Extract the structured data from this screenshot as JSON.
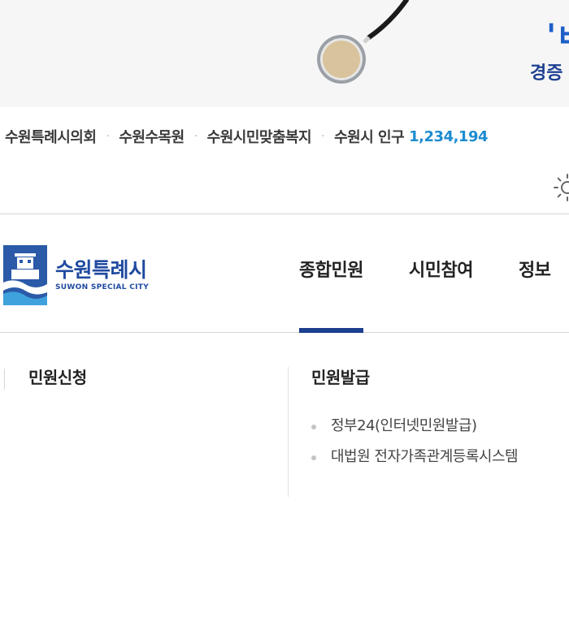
{
  "banner": {
    "headline": "'ㅂ",
    "subline": "경증"
  },
  "quick_links": [
    "수원특례시의회",
    "수원수목원",
    "수원시민맞춤복지"
  ],
  "population": {
    "label": "수원시 인구",
    "value": "1,234,194"
  },
  "header": {
    "logo_title": "수원특례시",
    "logo_subtitle": "SUWON SPECIAL CITY",
    "gnb": [
      "종합민원",
      "시민참여",
      "정보"
    ]
  },
  "submenu": {
    "left_title": "민원신청",
    "right_title": "민원발급",
    "right_items": [
      "정부24(인터넷민원발급)",
      "대법원 전자가족관계등록시스템"
    ]
  },
  "icons": {
    "theme_toggle": "sun-icon",
    "logo": "suwon-logo-icon"
  },
  "colors": {
    "brand_blue": "#1f4aa0",
    "accent_blue": "#1c8cd0",
    "active_underline": "#1c3f8f"
  }
}
